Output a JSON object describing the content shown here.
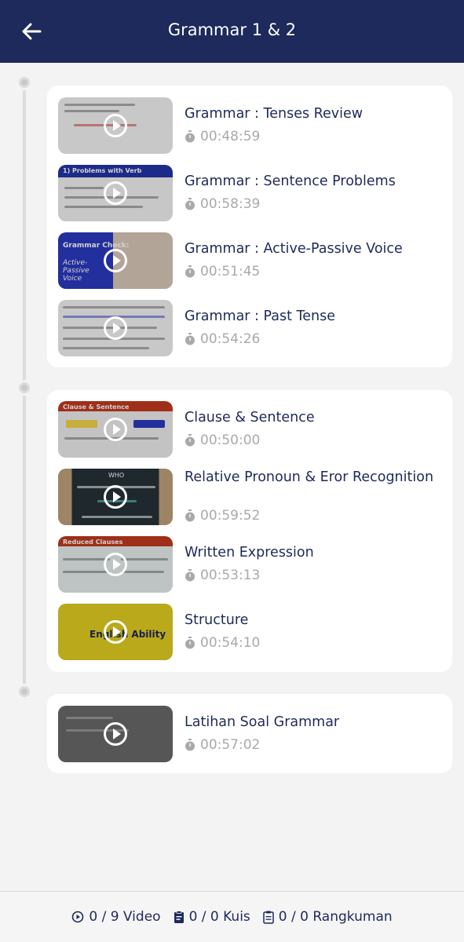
{
  "header": {
    "title": "Grammar 1 & 2"
  },
  "sections": [
    {
      "items": [
        {
          "title": "Grammar : Tenses Review",
          "duration": "00:48:59"
        },
        {
          "title": "Grammar : Sentence Problems",
          "duration": "00:58:39"
        },
        {
          "title": "Grammar : Active-Passive Voice",
          "duration": "00:51:45"
        },
        {
          "title": "Grammar : Past Tense",
          "duration": "00:54:26"
        }
      ]
    },
    {
      "items": [
        {
          "title": "Clause & Sentence",
          "duration": "00:50:00"
        },
        {
          "title": "Relative Pronoun & Eror Recognition",
          "duration": "00:59:52"
        },
        {
          "title": "Written Expression",
          "duration": "00:53:13"
        },
        {
          "title": "Structure",
          "duration": "00:54:10"
        }
      ]
    },
    {
      "items": [
        {
          "title": "Latihan Soal Grammar",
          "duration": "00:57:02"
        }
      ]
    }
  ],
  "thumbnails": {
    "problems_verb": "1) Problems with Verb",
    "grammar_check": "Grammar Check:",
    "active_passive": "Active-Passive Voice",
    "clause_sentence": "Clause & Sentence",
    "reduced_clauses": "Reduced Clauses",
    "who": "WHO",
    "english_ability": "English Ability"
  },
  "footer": {
    "video": "0 / 9 Video",
    "quiz": "0 / 0 Kuis",
    "summary": "0 / 0 Rangkuman"
  },
  "colors": {
    "primary": "#1d2a5b",
    "muted": "#a9a9a9",
    "background": "#f3f3f3"
  },
  "icons": [
    "back-arrow-icon",
    "play-icon",
    "stopwatch-icon",
    "play-circle-icon",
    "clipboard-icon",
    "document-icon"
  ]
}
